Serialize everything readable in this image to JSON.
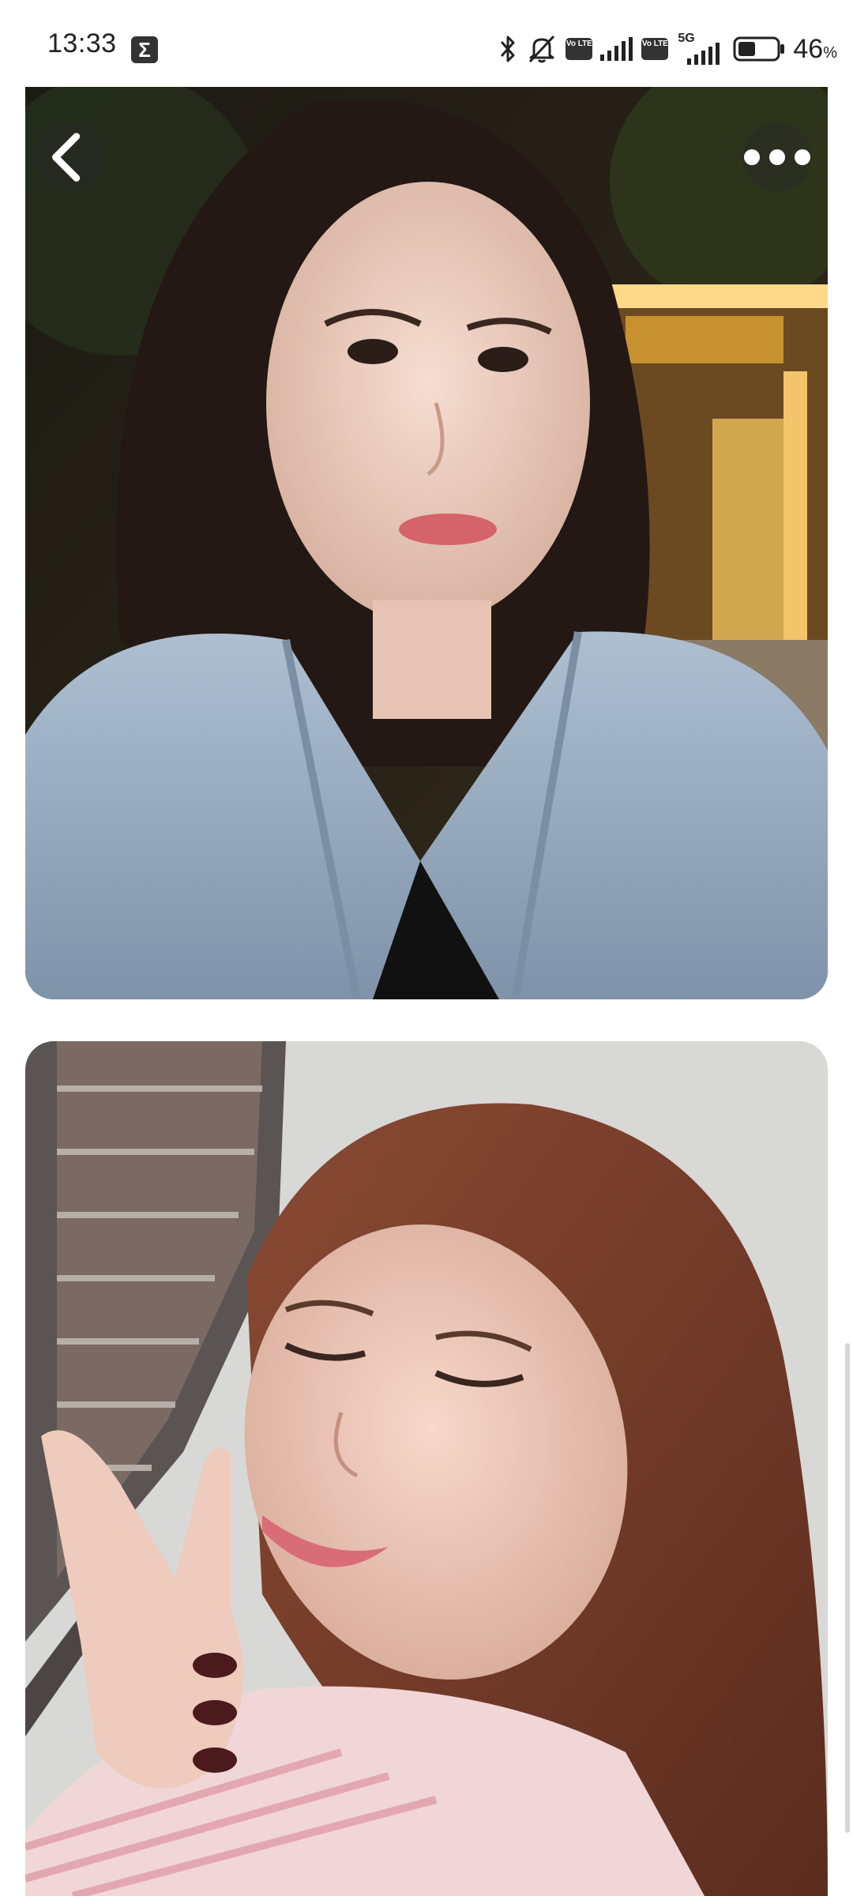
{
  "status_bar": {
    "time": "13:33",
    "battery_percent": "46",
    "battery_unit": "%",
    "network_label": "5G",
    "volte_label": "Vo LTE",
    "battery_level": 0.46
  },
  "photos": [
    {
      "alt": "Selfie at night in denim jacket in front of lit temple gate"
    },
    {
      "alt": "Selfie with peace sign, pink striped shirt"
    }
  ],
  "icons": {
    "back": "chevron-left-icon",
    "more": "more-horizontal-icon",
    "sigma": "sigma-icon"
  }
}
